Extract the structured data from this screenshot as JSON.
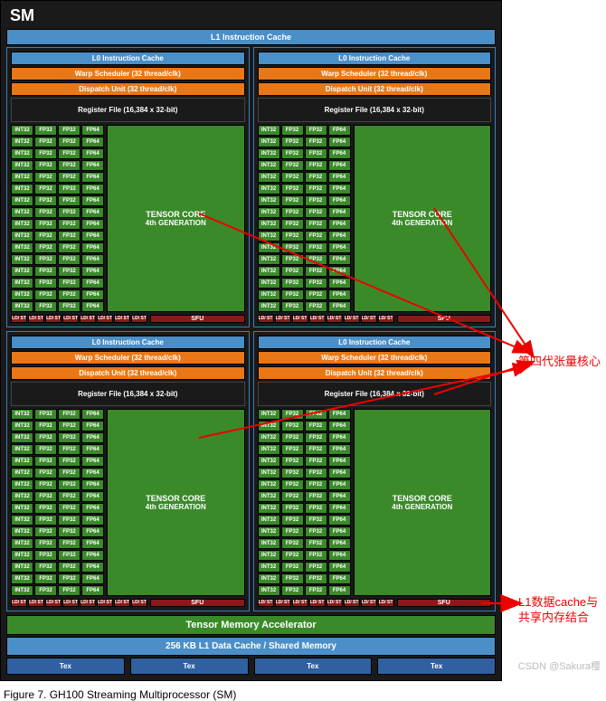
{
  "sm_title": "SM",
  "l1_instruction_cache": "L1 Instruction Cache",
  "quadrant": {
    "l0_instruction_cache": "L0 Instruction Cache",
    "warp_scheduler": "Warp Scheduler (32 thread/clk)",
    "dispatch_unit": "Dispatch Unit (32 thread/clk)",
    "register_file": "Register File (16,384 x 32-bit)",
    "col_labels": [
      "INT32",
      "FP32",
      "FP32",
      "FP64"
    ],
    "tensor_core_title": "TENSOR CORE",
    "tensor_core_gen": "4th GENERATION",
    "ldst_label": "LD/\nST",
    "sfu_label": "SFU"
  },
  "tma": "Tensor Memory Accelerator",
  "l1_data_cache": "256 KB L1 Data Cache / Shared Memory",
  "tex_label": "Tex",
  "caption": "Figure 7.     GH100 Streaming Multiprocessor (SM)",
  "watermark": "CSDN @Sakura樱",
  "annotations": {
    "tensor_label": "第四代张量核心",
    "l1d_label": "L1数据cache与共享内存结合"
  },
  "chart_data": {
    "type": "table",
    "architecture": "GH100 SM",
    "quadrants": 4,
    "per_quadrant": {
      "INT32_units": 16,
      "FP32_units": 32,
      "FP64_units": 16,
      "LDST_units": 8,
      "SFU_units": 1,
      "tensor_cores": 1,
      "tensor_core_generation": 4,
      "register_file": "16,384 x 32-bit",
      "warp_scheduler_threads_per_clk": 32,
      "dispatch_unit_threads_per_clk": 32
    },
    "shared": {
      "l1_data_cache_kb": 256,
      "tex_units": 4
    }
  }
}
